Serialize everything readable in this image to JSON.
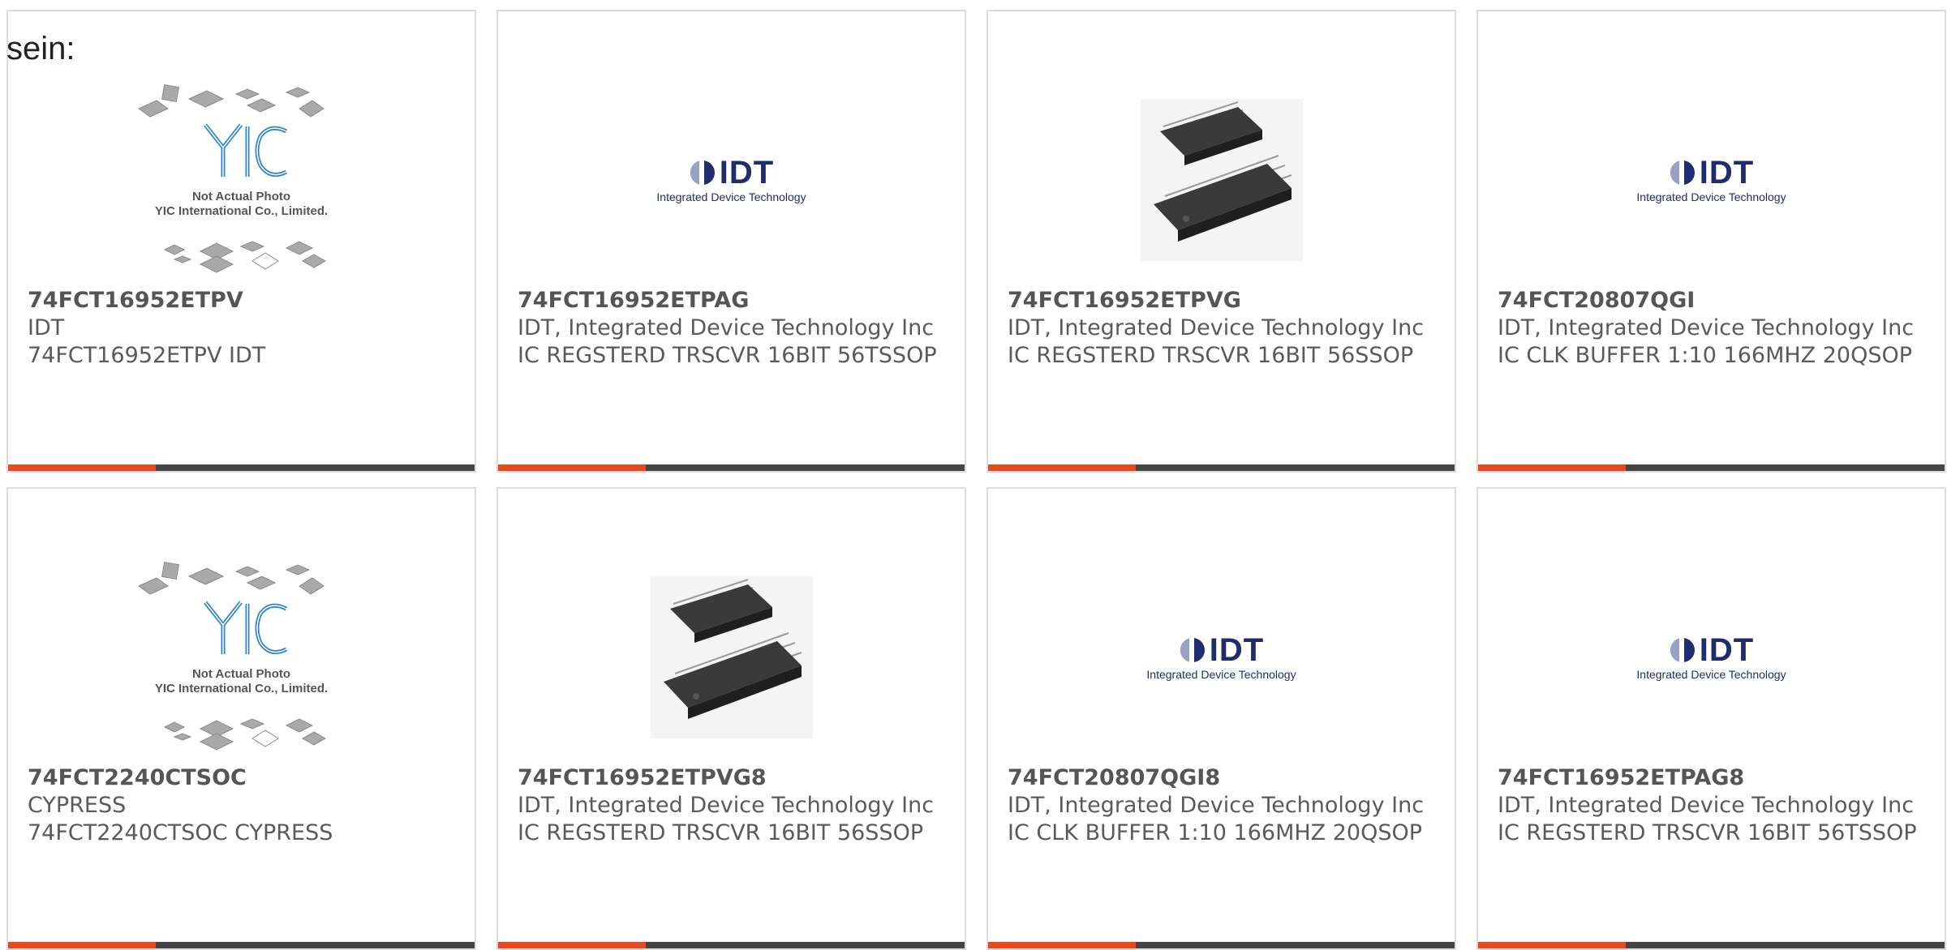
{
  "lead_text": "sein:",
  "colors": {
    "accent": "#e8491d",
    "bar": "#444444",
    "border": "#dcdcdc",
    "idt_blue": "#1f2d6e",
    "yic_blue": "#2f86c9"
  },
  "products": [
    {
      "part": "74FCT16952ETPV",
      "manufacturer": "IDT",
      "description": "74FCT16952ETPV IDT",
      "image": "yic-placeholder",
      "image_caption_1": "Not Actual Photo",
      "image_caption_2": "YIC International Co., Limited."
    },
    {
      "part": "74FCT16952ETPAG",
      "manufacturer": "IDT, Integrated Device Technology Inc",
      "description": "IC REGSTERD TRSCVR 16BIT 56TSSOP",
      "image": "idt-logo",
      "logo_word": "IDT",
      "logo_tag": "Integrated Device Technology"
    },
    {
      "part": "74FCT16952ETPVG",
      "manufacturer": "IDT, Integrated Device Technology Inc",
      "description": "IC REGSTERD TRSCVR 16BIT 56SSOP",
      "image": "chip-photo"
    },
    {
      "part": "74FCT20807QGI",
      "manufacturer": "IDT, Integrated Device Technology Inc",
      "description": "IC CLK BUFFER 1:10 166MHZ 20QSOP",
      "image": "idt-logo",
      "logo_word": "IDT",
      "logo_tag": "Integrated Device Technology"
    },
    {
      "part": "74FCT2240CTSOC",
      "manufacturer": "CYPRESS",
      "description": "74FCT2240CTSOC CYPRESS",
      "image": "yic-placeholder",
      "image_caption_1": "Not Actual Photo",
      "image_caption_2": "YIC International Co., Limited."
    },
    {
      "part": "74FCT16952ETPVG8",
      "manufacturer": "IDT, Integrated Device Technology Inc",
      "description": "IC REGSTERD TRSCVR 16BIT 56SSOP",
      "image": "chip-photo"
    },
    {
      "part": "74FCT20807QGI8",
      "manufacturer": "IDT, Integrated Device Technology Inc",
      "description": "IC CLK BUFFER 1:10 166MHZ 20QSOP",
      "image": "idt-logo",
      "logo_word": "IDT",
      "logo_tag": "Integrated Device Technology"
    },
    {
      "part": "74FCT16952ETPAG8",
      "manufacturer": "IDT, Integrated Device Technology Inc",
      "description": "IC REGSTERD TRSCVR 16BIT 56TSSOP",
      "image": "idt-logo",
      "logo_word": "IDT",
      "logo_tag": "Integrated Device Technology"
    }
  ]
}
